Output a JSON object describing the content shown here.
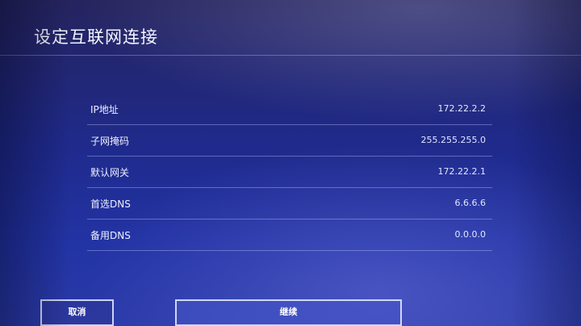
{
  "header": {
    "title": "设定互联网连接"
  },
  "settings": [
    {
      "label": "IP地址",
      "value": "172.22.2.2"
    },
    {
      "label": "子网掩码",
      "value": "255.255.255.0"
    },
    {
      "label": "默认网关",
      "value": "172.22.2.1"
    },
    {
      "label": "首选DNS",
      "value": "6.6.6.6"
    },
    {
      "label": "备用DNS",
      "value": "0.0.0.0"
    }
  ],
  "buttons": {
    "cancel_label": "取消",
    "continue_label": "继续"
  },
  "colors": {
    "background": "#1f2a8c",
    "text": "#eef0ff",
    "divider": "#bec8ff"
  }
}
